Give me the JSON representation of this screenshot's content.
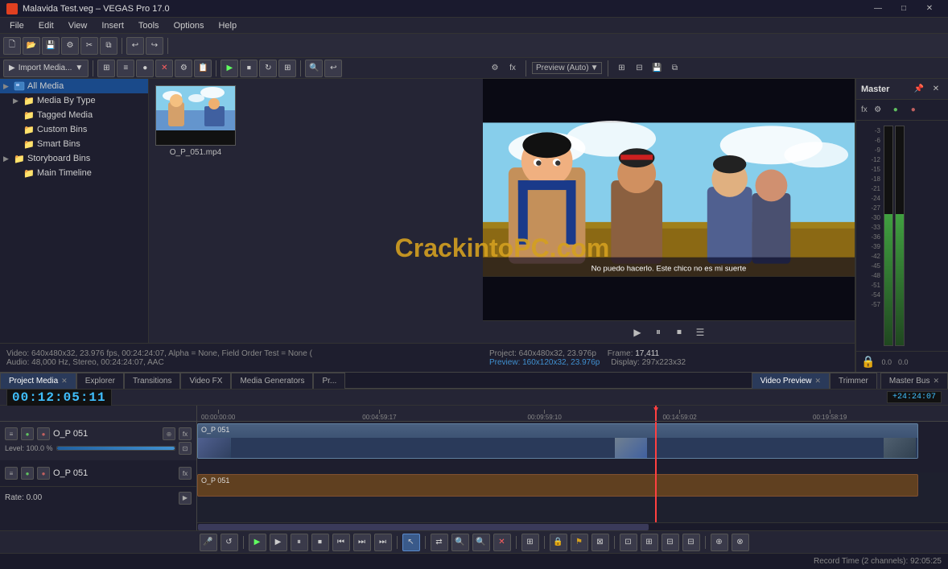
{
  "app": {
    "title": "Malavida Test.veg – VEGAS Pro 17.0",
    "icon": "V"
  },
  "titlebar": {
    "minimize": "—",
    "maximize": "□",
    "close": "✕"
  },
  "menu": {
    "items": [
      "File",
      "Edit",
      "View",
      "Insert",
      "Tools",
      "Options",
      "Help"
    ]
  },
  "left_panel": {
    "title": "Project Media",
    "import_btn": "Import Media...",
    "tree": [
      {
        "label": "All Media",
        "level": 0,
        "icon": "media",
        "expanded": true,
        "selected": true
      },
      {
        "label": "Media By Type",
        "level": 1,
        "icon": "folder-blue",
        "expanded": false
      },
      {
        "label": "Tagged Media",
        "level": 1,
        "icon": "folder-yellow"
      },
      {
        "label": "Custom Bins",
        "level": 1,
        "icon": "folder-yellow"
      },
      {
        "label": "Smart Bins",
        "level": 1,
        "icon": "folder-yellow"
      },
      {
        "label": "Storyboard Bins",
        "level": 0,
        "icon": "folder-yellow",
        "expanded": true
      },
      {
        "label": "Main Timeline",
        "level": 1,
        "icon": "folder-yellow"
      }
    ]
  },
  "media_file": {
    "name": "O_P_051.mp4"
  },
  "preview": {
    "dropdown": "Preview (Auto)",
    "project_info": "Project: 640x480x32, 23.976p",
    "frame_label": "Frame:",
    "frame_value": "17,411",
    "display_label": "Display:",
    "display_value": "297x223x32",
    "preview_res": "Preview: 160x120x32, 23.976p"
  },
  "video_info": {
    "line1": "Video: 640x480x32, 23.976 fps, 00:24:24:07, Alpha = None, Field Order Test = None (",
    "line2": "Audio: 48,000 Hz, Stereo, 00:24:24:07, AAC"
  },
  "master": {
    "label": "Master",
    "levels": [
      "-3",
      "-6",
      "-9",
      "-12",
      "-15",
      "-18",
      "-21",
      "-24",
      "-27",
      "-30",
      "-33",
      "-36",
      "-39",
      "-42",
      "-45",
      "-48",
      "-51",
      "-54",
      "-57"
    ],
    "bottom_vals": [
      "0.0",
      "0.0"
    ]
  },
  "bottom_tabs": [
    {
      "label": "Project Media",
      "active": true,
      "closable": true
    },
    {
      "label": "Explorer",
      "active": false,
      "closable": false
    },
    {
      "label": "Transitions",
      "active": false,
      "closable": false
    },
    {
      "label": "Video FX",
      "active": false,
      "closable": false
    },
    {
      "label": "Media Generators",
      "active": false,
      "closable": false
    },
    {
      "label": "Pr...",
      "active": false,
      "closable": false
    }
  ],
  "bottom_tabs_right": [
    {
      "label": "Video Preview",
      "active": true,
      "closable": true
    },
    {
      "label": "Trimmer",
      "active": false,
      "closable": false
    }
  ],
  "timeline": {
    "timecode": "00:12:05:11",
    "ruler_marks": [
      "00:00:00:00",
      "00:04:59:17",
      "00:09:59:10",
      "00:14:59:02",
      "00:19:58:19"
    ],
    "marker": "+24:24:07",
    "tracks": [
      {
        "name": "O_P 051",
        "level": "Level: 100.0 %",
        "type": "video"
      },
      {
        "name": "O_P 051",
        "type": "audio"
      }
    ]
  },
  "transport": {
    "buttons": [
      "⏮",
      "↺",
      "▶",
      "▶",
      "⏸",
      "⏹",
      "⏭",
      "⏭",
      "⏯",
      "⏯",
      "⏯"
    ],
    "record_time": "Record Time (2 channels): 92:05:25"
  },
  "rate": {
    "label": "Rate: 0.00"
  },
  "watermark": "CrackintoPC.com"
}
